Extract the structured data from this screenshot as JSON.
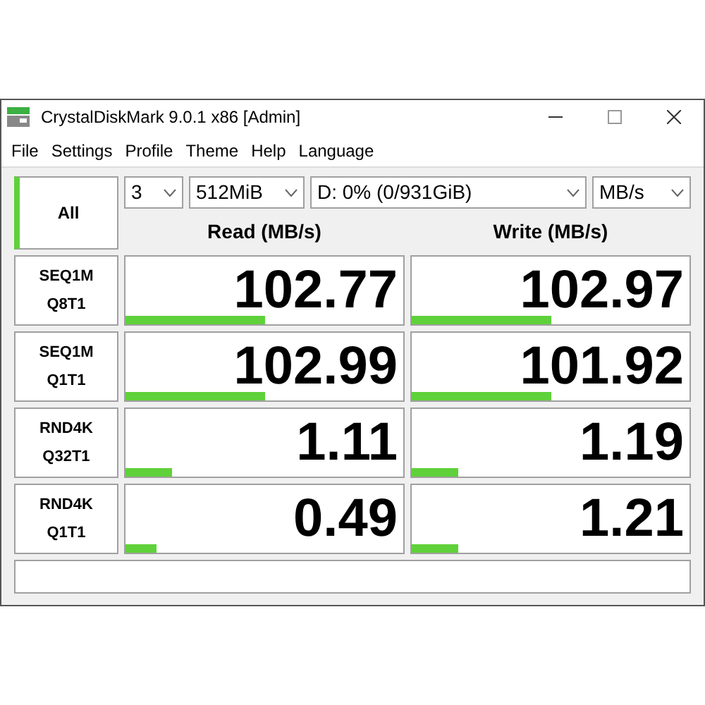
{
  "window": {
    "title": "CrystalDiskMark 9.0.1 x86 [Admin]"
  },
  "menu": [
    "File",
    "Settings",
    "Profile",
    "Theme",
    "Help",
    "Language"
  ],
  "all_button": {
    "label": "All"
  },
  "selects": [
    {
      "value": "3"
    },
    {
      "value": "512MiB"
    },
    {
      "value": "D: 0% (0/931GiB)"
    },
    {
      "value": "MB/s"
    }
  ],
  "columns": [
    "Read (MB/s)",
    "Write (MB/s)"
  ],
  "rows": [
    {
      "test": [
        "SEQ1M",
        "Q8T1"
      ],
      "read": {
        "value": "102.77",
        "level": 0.5
      },
      "write": {
        "value": "102.97",
        "level": 0.5
      }
    },
    {
      "test": [
        "SEQ1M",
        "Q1T1"
      ],
      "read": {
        "value": "102.99",
        "level": 0.5
      },
      "write": {
        "value": "101.92",
        "level": 0.5
      }
    },
    {
      "test": [
        "RND4K",
        "Q32T1"
      ],
      "read": {
        "value": "1.11",
        "level": 0.17
      },
      "write": {
        "value": "1.19",
        "level": 0.17
      }
    },
    {
      "test": [
        "RND4K",
        "Q1T1"
      ],
      "read": {
        "value": "0.49",
        "level": 0.11
      },
      "write": {
        "value": "1.21",
        "level": 0.17
      }
    }
  ]
}
